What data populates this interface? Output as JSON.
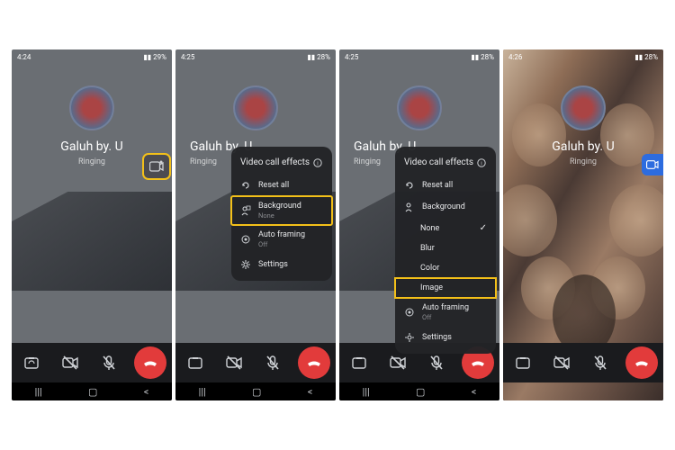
{
  "status_bar": {
    "times": [
      "4:24",
      "4:25",
      "4:25",
      "4:26"
    ],
    "battery": [
      "29%",
      "28%",
      "28%",
      "28%"
    ]
  },
  "contact": {
    "name": "Galuh by. U",
    "status": "Ringing"
  },
  "effects_panel": {
    "title": "Video call effects",
    "reset": "Reset all",
    "background": {
      "label": "Background",
      "value": "None"
    },
    "auto_framing": {
      "label": "Auto framing",
      "value": "Off"
    },
    "settings": "Settings",
    "background_options": {
      "none": "None",
      "blur": "Blur",
      "color": "Color",
      "image": "Image"
    }
  },
  "icons": {
    "effects": "video-effects",
    "info": "info",
    "reset": "refresh",
    "background": "person-bg",
    "autoframing": "target",
    "settings": "gear",
    "camera": "camera-flip",
    "video_off": "video-off",
    "mic_off": "mic-off",
    "end_call": "phone-hangup",
    "nav_recent": "recent",
    "nav_home": "home",
    "nav_back": "back"
  }
}
